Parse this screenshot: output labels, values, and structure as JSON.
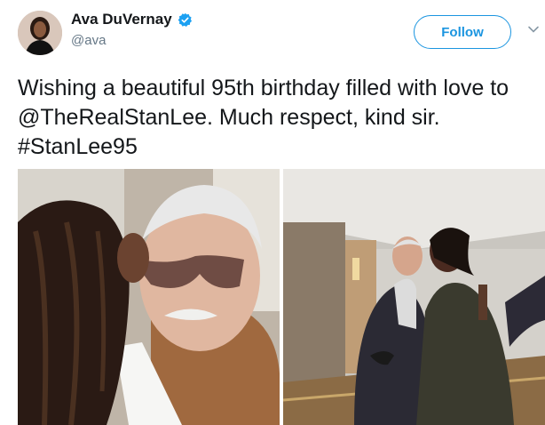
{
  "author": {
    "name": "Ava DuVernay",
    "handle": "@ava",
    "verified": true,
    "verified_color": "#1da1f2"
  },
  "follow_button": {
    "label": "Follow",
    "color": "#1b95e0"
  },
  "menu": {
    "icon": "chevron-down-icon"
  },
  "tweet": {
    "text": "Wishing a beautiful 95th birthday filled with love to @TheRealStanLee. Much respect, kind sir. #StanLee95"
  },
  "photos": [
    {
      "description_icon": "photo-kiss-closeup"
    },
    {
      "description_icon": "photo-hallway-kiss"
    }
  ]
}
